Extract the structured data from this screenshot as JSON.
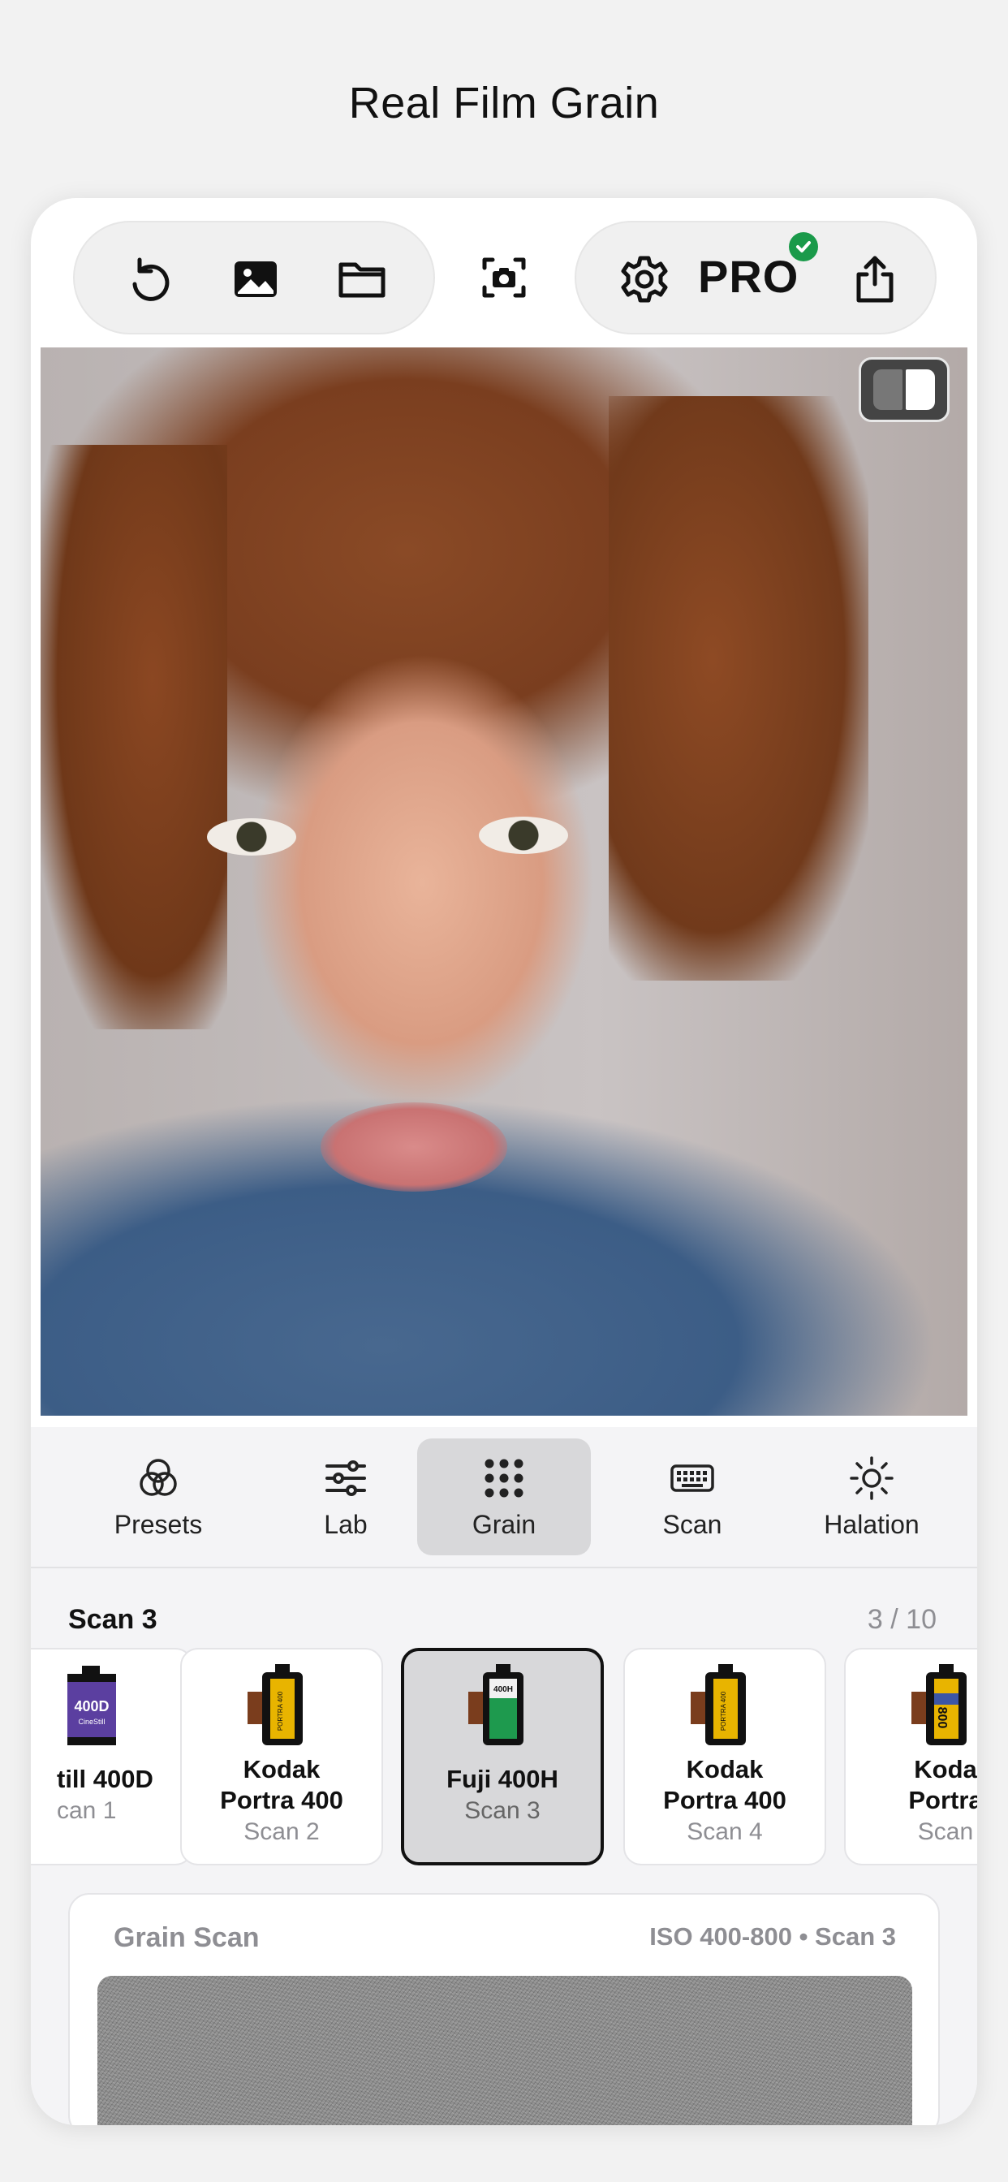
{
  "header": {
    "title": "Real Film Grain"
  },
  "toolbar": {
    "left": [
      {
        "name": "undo",
        "icon": "undo-icon"
      },
      {
        "name": "photo-library",
        "icon": "image-icon"
      },
      {
        "name": "open-folder",
        "icon": "folder-icon"
      }
    ],
    "center": {
      "name": "camera-capture",
      "icon": "camera-icon"
    },
    "right": {
      "settings_icon": "gear-icon",
      "pro_label": "PRO",
      "pro_status_icon": "checkmark-icon",
      "share_icon": "share-icon"
    }
  },
  "preview": {
    "compare_icon": "split-compare-icon"
  },
  "tabs": [
    {
      "label": "Presets",
      "icon": "presets-icon",
      "active": false
    },
    {
      "label": "Lab",
      "icon": "sliders-icon",
      "active": false
    },
    {
      "label": "Grain",
      "icon": "grain-dots-icon",
      "active": true
    },
    {
      "label": "Scan",
      "icon": "keyboard-icon",
      "active": false
    },
    {
      "label": "Halation",
      "icon": "sun-icon",
      "active": false
    }
  ],
  "scan": {
    "title": "Scan 3",
    "counter": "3 / 10",
    "films": [
      {
        "name": "till 400D",
        "scan": "can 1",
        "canister_label": "400D",
        "canister_sublabel": "CineStill",
        "color": "#5b3fa0"
      },
      {
        "name": "Kodak Portra 400",
        "name_line1": "Kodak",
        "name_line2": "Portra 400",
        "scan": "Scan 2",
        "canister_label": "PORTRA 400",
        "color": "#6b3a1f"
      },
      {
        "name": "Fuji 400H",
        "scan": "Scan 3",
        "canister_label": "400H",
        "color": "#1e9a4e",
        "selected": true
      },
      {
        "name": "Kodak Portra 400",
        "name_line1": "Kodak",
        "name_line2": "Portra 400",
        "scan": "Scan 4",
        "canister_label": "PORTRA 400",
        "color": "#6b3a1f"
      },
      {
        "name": "Koda Portra",
        "name_line1": "Koda",
        "name_line2": "Portra",
        "scan": "Scan",
        "canister_label": "800",
        "color": "#e8b400"
      }
    ]
  },
  "grain_card": {
    "title": "Grain Scan",
    "meta": "ISO 400-800 • Scan 3"
  }
}
